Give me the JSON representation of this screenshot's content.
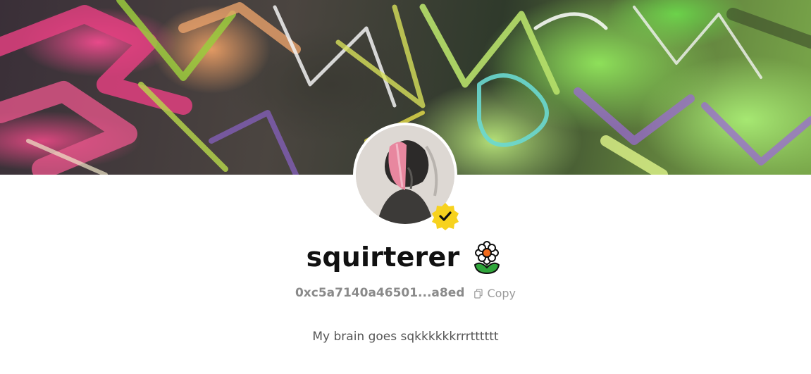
{
  "banner": {
    "icon": "abstract-artwork-banner"
  },
  "avatar": {
    "icon": "profile-avatar",
    "verified_icon": "verified-badge-icon",
    "verified_color": "#f7d21e"
  },
  "profile": {
    "username": "squirterer",
    "emoji_icon": "flower-emoji",
    "address": "0xc5a7140a46501...a8ed",
    "copy_label": "Copy",
    "bio": "My brain goes sqkkkkkkrrrtttttt"
  }
}
